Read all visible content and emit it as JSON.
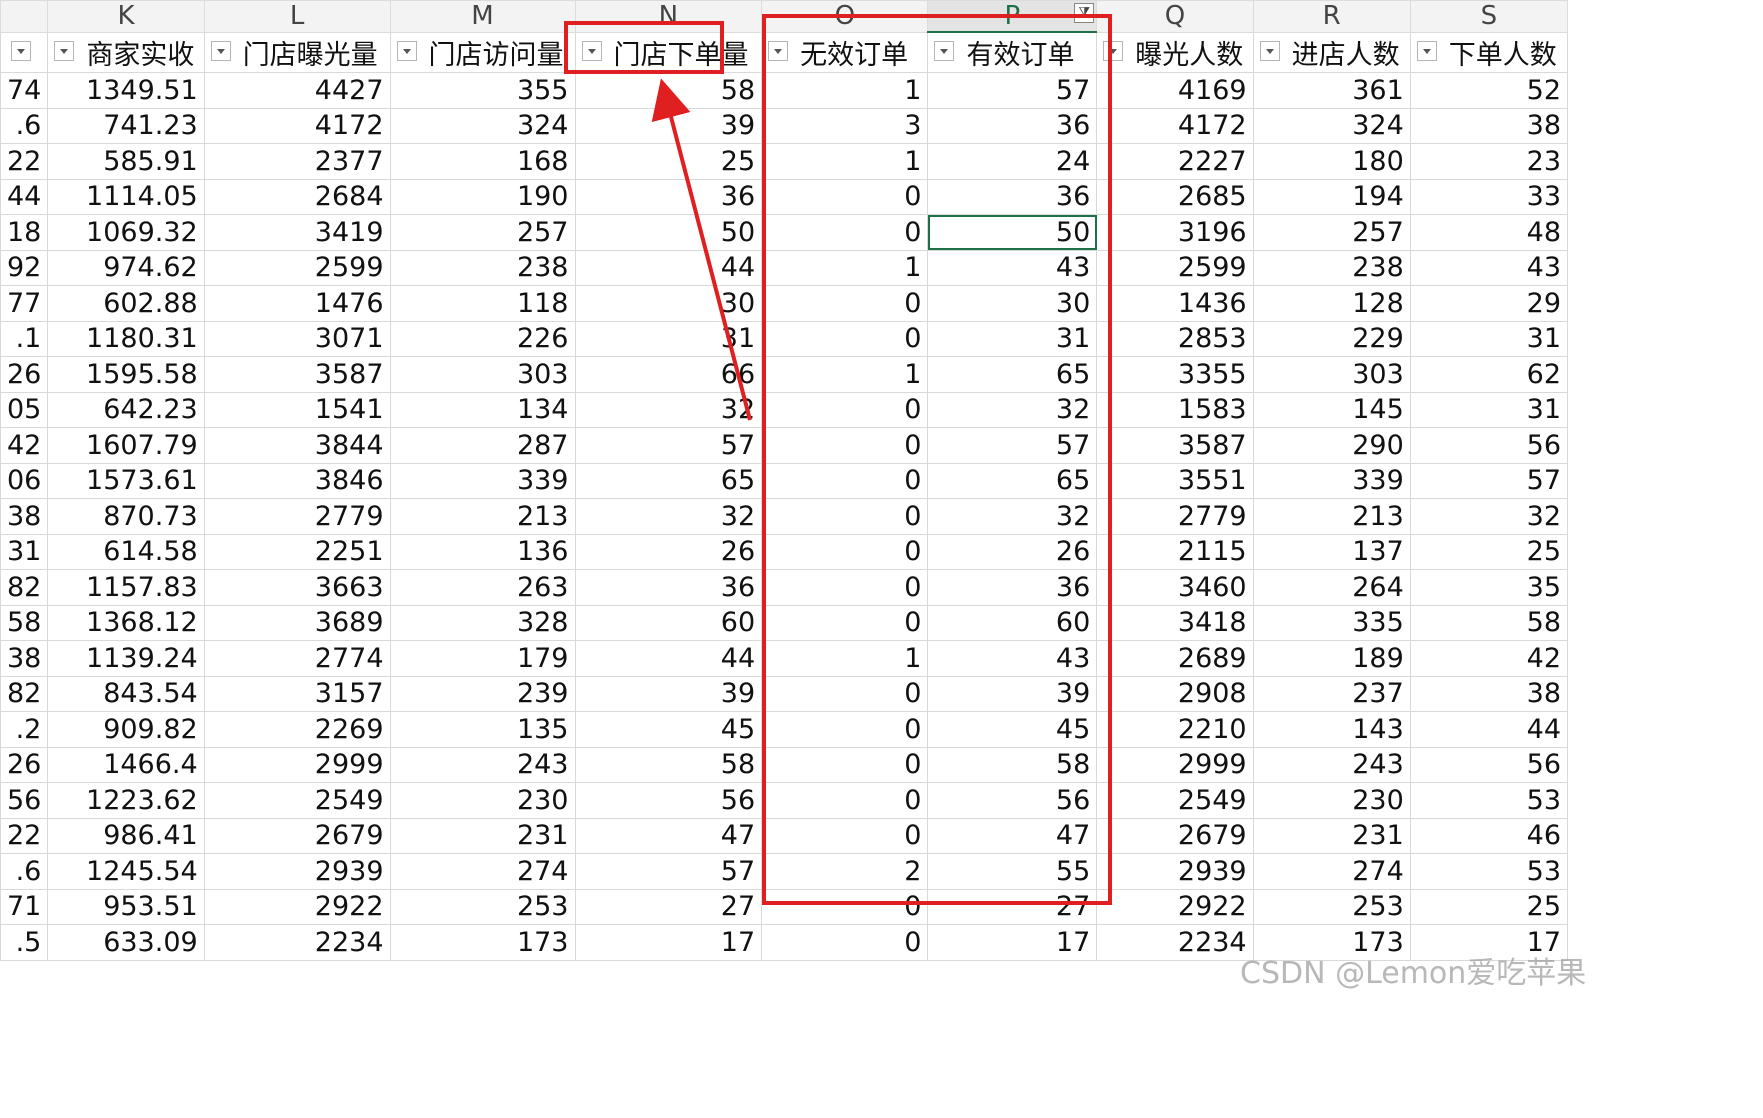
{
  "columns": [
    {
      "letter": "K",
      "header": "商家实收"
    },
    {
      "letter": "L",
      "header": "门店曝光量"
    },
    {
      "letter": "M",
      "header": "门店访问量"
    },
    {
      "letter": "N",
      "header": "门店下单量"
    },
    {
      "letter": "O",
      "header": "无效订单"
    },
    {
      "letter": "P",
      "header": "有效订单"
    },
    {
      "letter": "Q",
      "header": "曝光人数"
    },
    {
      "letter": "R",
      "header": "进店人数"
    },
    {
      "letter": "S",
      "header": "下单人数"
    }
  ],
  "rows": [
    [
      "74",
      "1349.51",
      "4427",
      "355",
      "58",
      "1",
      "57",
      "4169",
      "361",
      "52"
    ],
    [
      ".6",
      "741.23",
      "4172",
      "324",
      "39",
      "3",
      "36",
      "4172",
      "324",
      "38"
    ],
    [
      "22",
      "585.91",
      "2377",
      "168",
      "25",
      "1",
      "24",
      "2227",
      "180",
      "23"
    ],
    [
      "44",
      "1114.05",
      "2684",
      "190",
      "36",
      "0",
      "36",
      "2685",
      "194",
      "33"
    ],
    [
      "18",
      "1069.32",
      "3419",
      "257",
      "50",
      "0",
      "50",
      "3196",
      "257",
      "48"
    ],
    [
      "92",
      "974.62",
      "2599",
      "238",
      "44",
      "1",
      "43",
      "2599",
      "238",
      "43"
    ],
    [
      "77",
      "602.88",
      "1476",
      "118",
      "30",
      "0",
      "30",
      "1436",
      "128",
      "29"
    ],
    [
      ".1",
      "1180.31",
      "3071",
      "226",
      "31",
      "0",
      "31",
      "2853",
      "229",
      "31"
    ],
    [
      "26",
      "1595.58",
      "3587",
      "303",
      "66",
      "1",
      "65",
      "3355",
      "303",
      "62"
    ],
    [
      "05",
      "642.23",
      "1541",
      "134",
      "32",
      "0",
      "32",
      "1583",
      "145",
      "31"
    ],
    [
      "42",
      "1607.79",
      "3844",
      "287",
      "57",
      "0",
      "57",
      "3587",
      "290",
      "56"
    ],
    [
      "06",
      "1573.61",
      "3846",
      "339",
      "65",
      "0",
      "65",
      "3551",
      "339",
      "57"
    ],
    [
      "38",
      "870.73",
      "2779",
      "213",
      "32",
      "0",
      "32",
      "2779",
      "213",
      "32"
    ],
    [
      "31",
      "614.58",
      "2251",
      "136",
      "26",
      "0",
      "26",
      "2115",
      "137",
      "25"
    ],
    [
      "82",
      "1157.83",
      "3663",
      "263",
      "36",
      "0",
      "36",
      "3460",
      "264",
      "35"
    ],
    [
      "58",
      "1368.12",
      "3689",
      "328",
      "60",
      "0",
      "60",
      "3418",
      "335",
      "58"
    ],
    [
      "38",
      "1139.24",
      "2774",
      "179",
      "44",
      "1",
      "43",
      "2689",
      "189",
      "42"
    ],
    [
      "82",
      "843.54",
      "3157",
      "239",
      "39",
      "0",
      "39",
      "2908",
      "237",
      "38"
    ],
    [
      ".2",
      "909.82",
      "2269",
      "135",
      "45",
      "0",
      "45",
      "2210",
      "143",
      "44"
    ],
    [
      "26",
      "1466.4",
      "2999",
      "243",
      "58",
      "0",
      "58",
      "2999",
      "243",
      "56"
    ],
    [
      "56",
      "1223.62",
      "2549",
      "230",
      "56",
      "0",
      "56",
      "2549",
      "230",
      "53"
    ],
    [
      "22",
      "986.41",
      "2679",
      "231",
      "47",
      "0",
      "47",
      "2679",
      "231",
      "46"
    ],
    [
      ".6",
      "1245.54",
      "2939",
      "274",
      "57",
      "2",
      "55",
      "2939",
      "274",
      "53"
    ],
    [
      "71",
      "953.51",
      "2922",
      "253",
      "27",
      "0",
      "27",
      "2922",
      "253",
      "25"
    ],
    [
      ".5",
      "633.09",
      "2234",
      "173",
      "17",
      "0",
      "17",
      "2234",
      "173",
      "17"
    ]
  ],
  "watermark": "CSDN @Lemon爱吃苹果",
  "colors": {
    "highlight_red": "#e02020",
    "selection_green": "#1e7145"
  }
}
